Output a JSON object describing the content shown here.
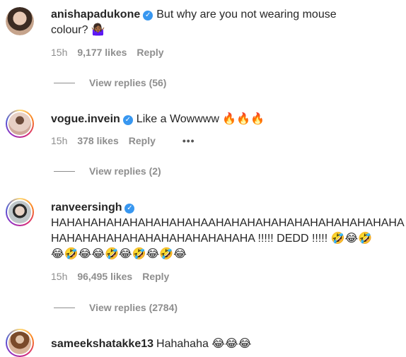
{
  "comments": [
    {
      "username": "anishapadukone",
      "text_line1": "But why are you not wearing mouse",
      "text_line2": "colour? 🤷🏾‍♀️",
      "time": "15h",
      "likes": "9,177 likes",
      "reply": "Reply",
      "view_replies": "View replies (56)",
      "avatar_ring": false,
      "avatar_color": "#c0a28c"
    },
    {
      "username": "vogue.invein",
      "text_line1": "Like a Wowwww 🔥🔥🔥",
      "time": "15h",
      "likes": "378 likes",
      "reply": "Reply",
      "more": "•••",
      "view_replies": "View replies (2)",
      "avatar_ring": true,
      "avatar_color": "#d6b4a8"
    },
    {
      "username": "ranveersingh",
      "text_line1": "HAHAHAHAHAHAHAHAHAHAAHAHAHAHAHAHAHAHAHAHAHAHA",
      "text_line2": "HAHAHAHAHAHAHAHAHAHAHAHAHA !!!!! DEDD !!!!! 🤣😂🤣",
      "text_line3": "😂🤣😂😂🤣😂🤣😂🤣😂",
      "time": "15h",
      "likes": "96,495 likes",
      "reply": "Reply",
      "view_replies": "View replies (2784)",
      "avatar_ring": true,
      "avatar_color": "#9aa3a8"
    },
    {
      "username": "sameekshatakke13",
      "text_line1": "Hahahaha 😂😂😂",
      "avatar_ring": true,
      "avatar_color": "#b98a6a"
    }
  ],
  "colors": {
    "verified": "#3897f0",
    "meta": "#8e8e8e",
    "text": "#262626"
  }
}
